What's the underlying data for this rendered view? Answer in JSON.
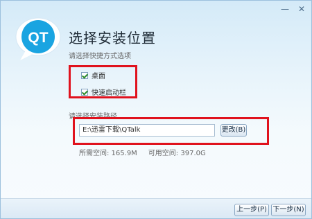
{
  "window": {
    "title": "选择安装位置",
    "subtitle": "请选择快捷方式选项"
  },
  "controls": {
    "minimize": "—",
    "close": "✕"
  },
  "logo": {
    "text": "QT",
    "color": "#1aa4e1"
  },
  "options": [
    {
      "label": "桌面",
      "checked": true
    },
    {
      "label": "快速启动栏",
      "checked": true
    }
  ],
  "install_path": {
    "label": "请选择安装路径",
    "value": "E:\\迅雷下载\\QTalk",
    "change_button": "更改(B)"
  },
  "space": {
    "required": "所需空间: 165.9M",
    "available": "可用空间: 397.0G"
  },
  "footer": {
    "prev_button": "上一步(P)",
    "next_button": "下一步(N)"
  },
  "colors": {
    "highlight": "#e0121d",
    "accent": "#1aa4e1"
  }
}
